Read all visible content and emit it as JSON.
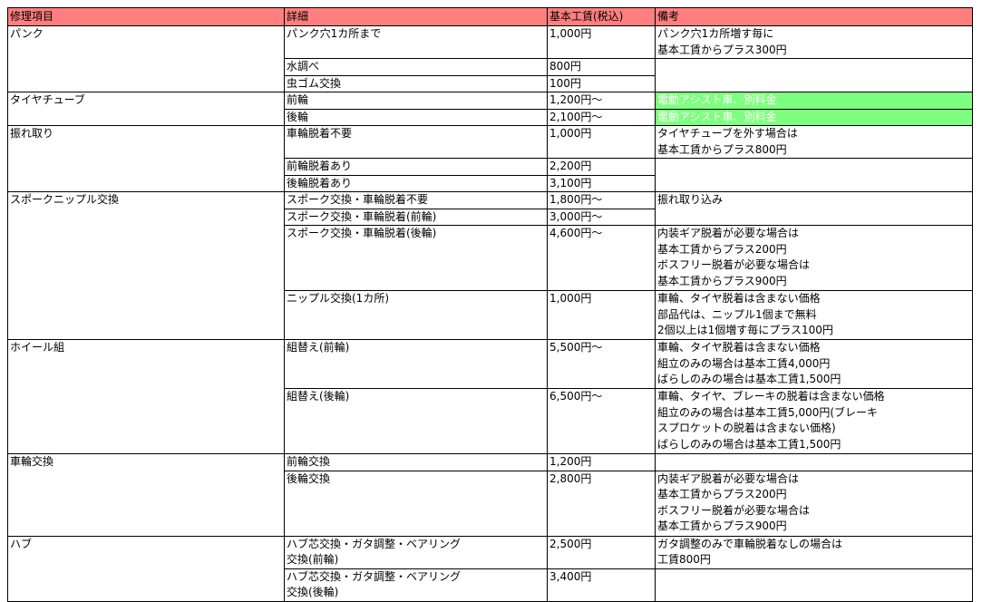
{
  "headers": [
    "修理項目",
    "詳細",
    "基本工賃(税込)",
    "備考"
  ],
  "colors": {
    "header_bg": "#ff7f7f",
    "note_green_bg": "#7fff7f"
  },
  "rows": [
    {
      "item": "パンク",
      "item_span": 3,
      "detail": "パンク穴1カ所まで",
      "price": "1,000円",
      "note": "パンク穴1カ所増す毎に\n基本工賃からプラス300円",
      "note_span": 1,
      "h": 36
    },
    {
      "detail": "水調べ",
      "price": "800円",
      "note": "",
      "note_span": 2,
      "h": 18
    },
    {
      "detail": "虫ゴム交換",
      "price": "100円",
      "h": 18
    },
    {
      "item": "タイヤチューブ",
      "item_span": 2,
      "detail": "前輪",
      "price": "1,200円〜",
      "note": "電動アシスト車、別料金",
      "note_span": 1,
      "note_class": "note-green",
      "h": 18
    },
    {
      "detail": "後輪",
      "price": "2,100円〜",
      "note": "電動アシスト車、別料金",
      "note_span": 1,
      "note_class": "note-green",
      "h": 18
    },
    {
      "item": "振れ取り",
      "item_span": 3,
      "detail": "車輪脱着不要",
      "price": "1,000円",
      "note": "タイヤチューブを外す場合は\n基本工賃からプラス800円",
      "note_span": 1,
      "h": 36
    },
    {
      "detail": "前輪脱着あり",
      "price": "2,200円",
      "note": "",
      "note_span": 2,
      "h": 18
    },
    {
      "detail": "後輪脱着あり",
      "price": "3,100円",
      "h": 18
    },
    {
      "item": "スポークニップル交換",
      "item_span": 4,
      "detail": "スポーク交換・車輪脱着不要",
      "price": "1,800円〜",
      "note": "振れ取り込み",
      "note_span": 2,
      "h": 18
    },
    {
      "detail": "スポーク交換・車輪脱着(前輪)",
      "price": "3,000円〜",
      "h": 18
    },
    {
      "detail": "スポーク交換・車輪脱着(後輪)",
      "price": "4,600円〜",
      "note": "内装ギア脱着が必要な場合は\n基本工賃からプラス200円\nボスフリー脱着が必要な場合は\n基本工賃からプラス900円",
      "note_span": 1,
      "h": 72
    },
    {
      "detail": "ニップル交換(1カ所)",
      "price": "1,000円",
      "note": "車輪、タイヤ脱着は含まない価格\n部品代は、ニップル1個まで無料\n2個以上は1個増す毎にプラス100円",
      "note_span": 1,
      "h": 54
    },
    {
      "item": "ホイール組",
      "item_span": 2,
      "detail": "組替え(前輪)",
      "price": "5,500円〜",
      "note": "車輪、タイヤ脱着は含まない価格\n組立のみの場合は基本工賃4,000円\nばらしのみの場合は基本工賃1,500円",
      "note_span": 1,
      "h": 54
    },
    {
      "detail": "組替え(後輪)",
      "price": "6,500円〜",
      "note": "車輪、タイヤ、ブレーキの脱着は含まない価格\n組立のみの場合は基本工賃5,000円(ブレーキ\nスプロケットの脱着は含まない価格)\nばらしのみの場合は基本工賃1,500円",
      "note_span": 1,
      "h": 72
    },
    {
      "item": "車輪交換",
      "item_span": 2,
      "detail": "前輪交換",
      "price": "1,200円",
      "note": "",
      "note_span": 1,
      "h": 18
    },
    {
      "detail": "後輪交換",
      "price": "2,800円",
      "note": "内装ギア脱着が必要な場合は\n基本工賃からプラス200円\nボスフリー脱着が必要な場合は\n基本工賃からプラス900円",
      "note_span": 1,
      "h": 72
    },
    {
      "item": "ハブ",
      "item_span": 2,
      "detail": "ハブ芯交換・ガタ調整・ベアリング\n交換(前輪)",
      "price": "2,500円",
      "note": "ガタ調整のみで車輪脱着なしの場合は\n工賃800円",
      "note_span": 1,
      "h": 36
    },
    {
      "detail": "ハブ芯交換・ガタ調整・ベアリング\n交換(後輪)",
      "price": "3,400円",
      "note": "",
      "note_span": 1,
      "h": 36
    }
  ]
}
